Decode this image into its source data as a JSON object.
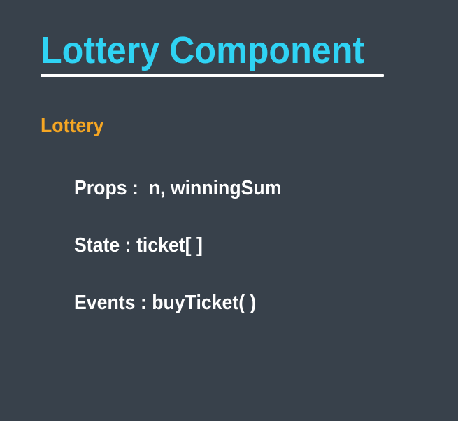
{
  "slide": {
    "title": "Lottery Component",
    "section_label": "Lottery",
    "lines": {
      "props": "Props :  n, winningSum",
      "state": "State : ticket[ ]",
      "events": "Events : buyTicket( )"
    }
  },
  "colors": {
    "background": "#38414b",
    "title": "#2fd3f4",
    "section_label": "#f5a623",
    "body_text": "#ffffff"
  }
}
